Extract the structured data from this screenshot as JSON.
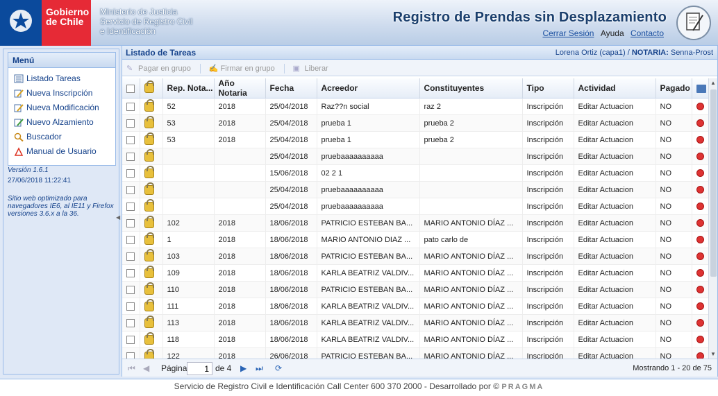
{
  "header": {
    "brand_line1": "Gobierno",
    "brand_line2": "de Chile",
    "ministry_line1": "Ministerio de Justicia",
    "ministry_line2": "Servicio de Registro Civil",
    "ministry_line3": "e Identificación",
    "app_title": "Registro de Prendas sin Desplazamiento",
    "logout": "Cerrar Sesión",
    "help": "Ayuda",
    "contact": "Contacto"
  },
  "sidebar": {
    "menu_title": "Menú",
    "items": [
      {
        "label": "Listado Tareas",
        "icon": "list-icon"
      },
      {
        "label": "Nueva Inscripción",
        "icon": "edit-icon"
      },
      {
        "label": "Nueva Modificación",
        "icon": "edit-icon"
      },
      {
        "label": "Nuevo Alzamiento",
        "icon": "edit-icon"
      },
      {
        "label": "Buscador",
        "icon": "search-icon"
      },
      {
        "label": "Manual de Usuario",
        "icon": "pdf-icon"
      }
    ],
    "version": "Versión 1.6.1",
    "datetime": "27/06/2018 11:22:41",
    "browser_note": "Sitio web optimizado para navegadores IE6, al IE11 y Firefox versiones 3.6.x a la 36."
  },
  "main": {
    "title": "Listado de Tareas",
    "user": "Lorena Ortiz (capa1) / ",
    "notaria_label": "NOTARIA:",
    "notaria_value": " Senna-Prost",
    "toolbar": {
      "pay_group": "Pagar en grupo",
      "sign_group": "Firmar en grupo",
      "release": "Liberar"
    },
    "columns": [
      "Rep. Nota...",
      "Año Notaria",
      "Fecha",
      "Acreedor",
      "Constituyentes",
      "Tipo",
      "Actividad",
      "Pagado"
    ],
    "rows": [
      {
        "rep": "52",
        "anio": "2018",
        "fecha": "25/04/2018",
        "acreedor": "Raz??n social",
        "const": "raz 2",
        "tipo": "Inscripción",
        "act": "Editar Actuacion",
        "pagado": "NO"
      },
      {
        "rep": "53",
        "anio": "2018",
        "fecha": "25/04/2018",
        "acreedor": "prueba 1",
        "const": "prueba 2",
        "tipo": "Inscripción",
        "act": "Editar Actuacion",
        "pagado": "NO"
      },
      {
        "rep": "53",
        "anio": "2018",
        "fecha": "25/04/2018",
        "acreedor": "prueba 1",
        "const": "prueba 2",
        "tipo": "Inscripción",
        "act": "Editar Actuacion",
        "pagado": "NO"
      },
      {
        "rep": "",
        "anio": "",
        "fecha": "25/04/2018",
        "acreedor": "pruebaaaaaaaaaa",
        "const": "",
        "tipo": "Inscripción",
        "act": "Editar Actuacion",
        "pagado": "NO"
      },
      {
        "rep": "",
        "anio": "",
        "fecha": "15/06/2018",
        "acreedor": "02 2 1",
        "const": "",
        "tipo": "Inscripción",
        "act": "Editar Actuacion",
        "pagado": "NO"
      },
      {
        "rep": "",
        "anio": "",
        "fecha": "25/04/2018",
        "acreedor": "pruebaaaaaaaaaa",
        "const": "",
        "tipo": "Inscripción",
        "act": "Editar Actuacion",
        "pagado": "NO"
      },
      {
        "rep": "",
        "anio": "",
        "fecha": "25/04/2018",
        "acreedor": "pruebaaaaaaaaaa",
        "const": "",
        "tipo": "Inscripción",
        "act": "Editar Actuacion",
        "pagado": "NO"
      },
      {
        "rep": "102",
        "anio": "2018",
        "fecha": "18/06/2018",
        "acreedor": "PATRICIO ESTEBAN BA...",
        "const": "MARIO ANTONIO DÍAZ ...",
        "tipo": "Inscripción",
        "act": "Editar Actuacion",
        "pagado": "NO"
      },
      {
        "rep": "1",
        "anio": "2018",
        "fecha": "18/06/2018",
        "acreedor": "MARIO ANTONIO DIAZ ...",
        "const": "pato carlo de",
        "tipo": "Inscripción",
        "act": "Editar Actuacion",
        "pagado": "NO"
      },
      {
        "rep": "103",
        "anio": "2018",
        "fecha": "18/06/2018",
        "acreedor": "PATRICIO ESTEBAN BA...",
        "const": "MARIO ANTONIO DÍAZ ...",
        "tipo": "Inscripción",
        "act": "Editar Actuacion",
        "pagado": "NO"
      },
      {
        "rep": "109",
        "anio": "2018",
        "fecha": "18/06/2018",
        "acreedor": "KARLA BEATRIZ VALDIV...",
        "const": "MARIO ANTONIO DÍAZ ...",
        "tipo": "Inscripción",
        "act": "Editar Actuacion",
        "pagado": "NO"
      },
      {
        "rep": "110",
        "anio": "2018",
        "fecha": "18/06/2018",
        "acreedor": "PATRICIO ESTEBAN BA...",
        "const": "MARIO ANTONIO DÍAZ ...",
        "tipo": "Inscripción",
        "act": "Editar Actuacion",
        "pagado": "NO"
      },
      {
        "rep": "111",
        "anio": "2018",
        "fecha": "18/06/2018",
        "acreedor": "KARLA BEATRIZ VALDIV...",
        "const": "MARIO ANTONIO DÍAZ ...",
        "tipo": "Inscripción",
        "act": "Editar Actuacion",
        "pagado": "NO"
      },
      {
        "rep": "113",
        "anio": "2018",
        "fecha": "18/06/2018",
        "acreedor": "KARLA BEATRIZ VALDIV...",
        "const": "MARIO ANTONIO DÍAZ ...",
        "tipo": "Inscripción",
        "act": "Editar Actuacion",
        "pagado": "NO"
      },
      {
        "rep": "118",
        "anio": "2018",
        "fecha": "18/06/2018",
        "acreedor": "KARLA BEATRIZ VALDIV...",
        "const": "MARIO ANTONIO DÍAZ ...",
        "tipo": "Inscripción",
        "act": "Editar Actuacion",
        "pagado": "NO"
      },
      {
        "rep": "122",
        "anio": "2018",
        "fecha": "26/06/2018",
        "acreedor": "PATRICIO ESTEBAN BA...",
        "const": "MARIO ANTONIO DÍAZ ...",
        "tipo": "Inscripción",
        "act": "Editar Actuacion",
        "pagado": "NO"
      }
    ],
    "pager": {
      "page_label": "Página",
      "page_value": "1",
      "of_label": "de 4",
      "display": "Mostrando 1 - 20 de 75"
    }
  },
  "footer": {
    "text": "Servicio de Registro Civil e Identificación   Call Center 600 370 2000 - Desarrollado por © ",
    "brand": "PRAGMA"
  }
}
